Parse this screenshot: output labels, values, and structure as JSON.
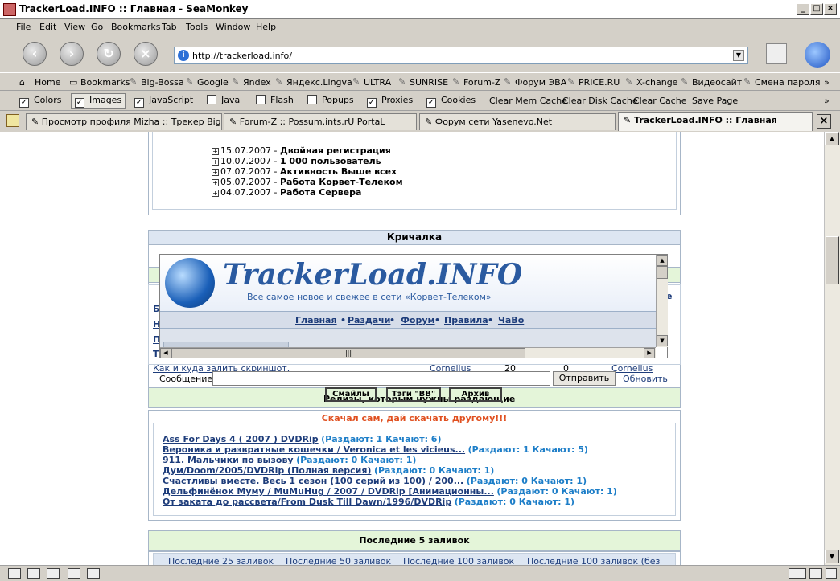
{
  "window": {
    "title": "TrackerLoad.INFO :: Главная - SeaMonkey"
  },
  "menu": [
    "File",
    "Edit",
    "View",
    "Go",
    "Bookmarks",
    "Tab",
    "Tools",
    "Window",
    "Help"
  ],
  "url": "http://trackerload.info/",
  "bookmarks": [
    "Home",
    "Bookmarks",
    "Big-Bossa",
    "Google",
    "Яndex",
    "Яндекс.Lingva",
    "ULTRA",
    "SUNRISE",
    "Forum-Z",
    "Форум ЭВА",
    "PRICE.RU",
    "X-change",
    "Видеосайт",
    "Смена пароля"
  ],
  "prefbar": {
    "checks": [
      {
        "label": "Colors",
        "checked": true
      },
      {
        "label": "Images",
        "checked": true
      },
      {
        "label": "JavaScript",
        "checked": true
      },
      {
        "label": "Java",
        "checked": false
      },
      {
        "label": "Flash",
        "checked": false
      },
      {
        "label": "Popups",
        "checked": false
      },
      {
        "label": "Proxies",
        "checked": true
      },
      {
        "label": "Cookies",
        "checked": true
      }
    ],
    "buttons": [
      "Clear Mem Cache",
      "Clear Disk Cache",
      "Clear Cache",
      "Save Page"
    ]
  },
  "tabs": [
    {
      "label": "Просмотр профиля Mizha :: Трекер Big-B...",
      "active": false
    },
    {
      "label": "Forum-Z :: Possum.ints.rU PortaL",
      "active": false
    },
    {
      "label": "Форум сети Yasenevo.Net",
      "active": false
    },
    {
      "label": "TrackerLoad.INFO :: Главная",
      "active": true
    }
  ],
  "news": [
    {
      "date": "15.07.2007",
      "title": "Двойная регистрация"
    },
    {
      "date": "10.07.2007",
      "title": "1 000 пользователь"
    },
    {
      "date": "07.07.2007",
      "title": "Активность Выше всех"
    },
    {
      "date": "05.07.2007",
      "title": "Работа Корвет-Телеком"
    },
    {
      "date": "04.07.2007",
      "title": "Работа Сервера"
    }
  ],
  "shout": {
    "header": "Кричалка",
    "logo_title": "TrackerLoad.INFO",
    "logo_subtitle": "Все самое новое и свежее в сети «Корвет-Телеком»",
    "nav": [
      "Главная",
      "Раздачи",
      "Форум",
      "Правила",
      "ЧаВо"
    ],
    "row_topic": "Как и куда залить скриншот.",
    "row_author": "Cornelius",
    "row_n1": "20",
    "row_n2": "0",
    "row_last": "Cornelius",
    "message_label": "Сообщение:",
    "send": "Отправить",
    "refresh": "Обновить",
    "btn_smiles": "Смайлы",
    "btn_bb": "Тэги \"BB\"",
    "btn_archive": "Архив",
    "overlap_text": "Релизы, которым нужны раздающие"
  },
  "releases": {
    "slogan": "Скачал сам, дай скачать другому!!!",
    "items": [
      {
        "title": "Ass For Days 4 ( 2007 ) DVDRip",
        "stats": "(Раздают: 1 Качают: 6)"
      },
      {
        "title": "Вероника и развратные кошечки / Veronica et les vicieus...",
        "stats": "(Раздают: 1 Качают: 5)"
      },
      {
        "title": "911. Мальчики по вызову",
        "stats": "(Раздают: 0 Качают: 1)"
      },
      {
        "title": "Дум/Doom/2005/DVDRip (Полная версия)",
        "stats": "(Раздают: 0 Качают: 1)"
      },
      {
        "title": "Счастливы вместе. Весь 1 сезон (100 серий из 100) / 200...",
        "stats": "(Раздают: 0 Качают: 1)"
      },
      {
        "title": "Дельфинёнок Муму / MuMuHug / 2007 / DVDRip [Анимационны...",
        "stats": "(Раздают: 0 Качают: 1)"
      },
      {
        "title": "От заката до рассвета/From Dusk Till Dawn/1996/DVDRip",
        "stats": "(Раздают: 0 Качают: 1)"
      }
    ]
  },
  "uploads": {
    "header": "Последние 5 заливок",
    "links": [
      "Последние 25 заливок",
      "Последние 50 заливок",
      "Последние 100 заливок",
      "Последние 100 заливок (без"
    ]
  }
}
